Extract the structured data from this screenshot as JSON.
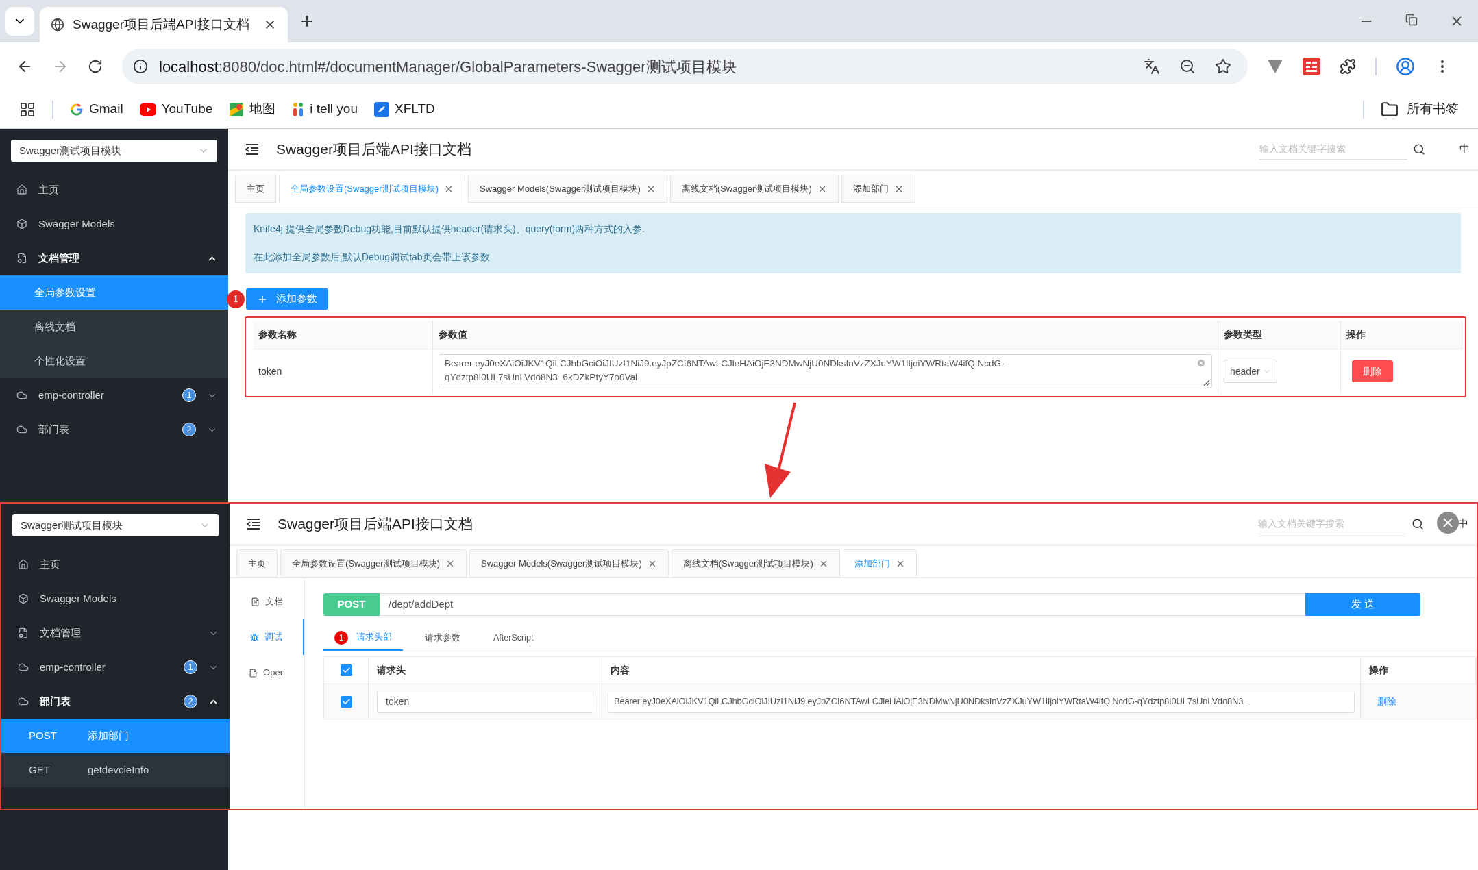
{
  "browser": {
    "tab_title": "Swagger项目后端API接口文档",
    "url_host": "localhost",
    "url_path": ":8080/doc.html#/documentManager/GlobalParameters-Swagger测试项目模块",
    "bookmarks": [
      {
        "label": "Gmail"
      },
      {
        "label": "YouTube"
      },
      {
        "label": "地图"
      },
      {
        "label": "i tell you"
      },
      {
        "label": "XFLTD"
      }
    ],
    "all_bookmarks": "所有书签"
  },
  "upper": {
    "sidebar": {
      "select": "Swagger测试项目模块",
      "items": [
        {
          "label": "主页"
        },
        {
          "label": "Swagger Models"
        },
        {
          "label": "文档管理",
          "expanded": true,
          "children": [
            {
              "label": "全局参数设置",
              "selected": true
            },
            {
              "label": "离线文档",
              "selected": false
            },
            {
              "label": "个性化设置",
              "selected": false
            }
          ]
        },
        {
          "label": "emp-controller",
          "badge": "1",
          "expanded": false
        },
        {
          "label": "部门表",
          "badge": "2",
          "expanded": false
        }
      ]
    },
    "header": {
      "title": "Swagger项目后端API接口文档",
      "search_placeholder": "输入文档关键字搜索",
      "language": "中"
    },
    "tabs": [
      {
        "label": "主页",
        "selected": false,
        "closable": false
      },
      {
        "label": "全局参数设置(Swagger测试项目模块)",
        "selected": true,
        "closable": true
      },
      {
        "label": "Swagger Models(Swagger测试项目模块)",
        "selected": false,
        "closable": true
      },
      {
        "label": "离线文档(Swagger测试项目模块)",
        "selected": false,
        "closable": true
      },
      {
        "label": "添加部门",
        "selected": false,
        "closable": true
      }
    ],
    "notice": [
      "Knife4j 提供全局参数Debug功能,目前默认提供header(请求头)、query(form)两种方式的入参.",
      "在此添加全局参数后,默认Debug调试tab页会带上该参数"
    ],
    "step_badge": "1",
    "add_button": "添加参数",
    "table": {
      "columns": [
        "参数名称",
        "参数值",
        "参数类型",
        "操作"
      ],
      "rows": [
        {
          "name": "token",
          "value": "Bearer eyJ0eXAiOiJKV1QiLCJhbGciOiJIUzI1NiJ9.eyJpZCI6NTAwLCJleHAiOjE3NDMwNjU0NDksInVzZXJuYW1lIjoiYWRtaW4ifQ.NcdG-qYdztp8I0UL7sUnLVdo8N3_6kDZkPtyY7o0Val",
          "type": "header",
          "action": "删除"
        }
      ]
    }
  },
  "lower": {
    "sidebar": {
      "select": "Swagger测试项目模块",
      "items": [
        {
          "label": "主页"
        },
        {
          "label": "Swagger Models"
        },
        {
          "label": "文档管理",
          "expanded": false
        },
        {
          "label": "emp-controller",
          "badge": "1",
          "expanded": false
        },
        {
          "label": "部门表",
          "badge": "2",
          "expanded": true,
          "children": [
            {
              "method": "POST",
              "label": "添加部门",
              "selected": true
            },
            {
              "method": "GET",
              "label": "getdevcieInfo",
              "selected": false
            }
          ]
        }
      ]
    },
    "header": {
      "title": "Swagger项目后端API接口文档",
      "search_placeholder": "输入文档关键字搜索",
      "language": "中"
    },
    "tabs": [
      {
        "label": "主页",
        "selected": false,
        "closable": false
      },
      {
        "label": "全局参数设置(Swagger测试项目模块)",
        "selected": false,
        "closable": true
      },
      {
        "label": "Swagger Models(Swagger测试项目模块)",
        "selected": false,
        "closable": true
      },
      {
        "label": "离线文档(Swagger测试项目模块)",
        "selected": false,
        "closable": true
      },
      {
        "label": "添加部门",
        "selected": true,
        "closable": true
      }
    ],
    "side_tabs": [
      {
        "label": "文档",
        "selected": false
      },
      {
        "label": "调试",
        "selected": true
      },
      {
        "label": "Open",
        "selected": false
      }
    ],
    "method": "POST",
    "path": "/dept/addDept",
    "send_button": "发 送",
    "sub_tabs": [
      {
        "label": "请求头部",
        "selected": true,
        "badge": "1"
      },
      {
        "label": "请求参数",
        "selected": false
      },
      {
        "label": "AfterScript",
        "selected": false
      }
    ],
    "table": {
      "all_checked": true,
      "columns": [
        "请求头",
        "内容",
        "操作"
      ],
      "rows": [
        {
          "checked": true,
          "header": "token",
          "content": "Bearer eyJ0eXAiOiJKV1QiLCJhbGciOiJIUzI1NiJ9.eyJpZCI6NTAwLCJleHAiOjE3NDMwNjU0NDksInVzZXJuYW1lIjoiYWRtaW4ifQ.NcdG-qYdztp8I0UL7sUnLVdo8N3_",
          "action": "删除"
        }
      ]
    }
  }
}
